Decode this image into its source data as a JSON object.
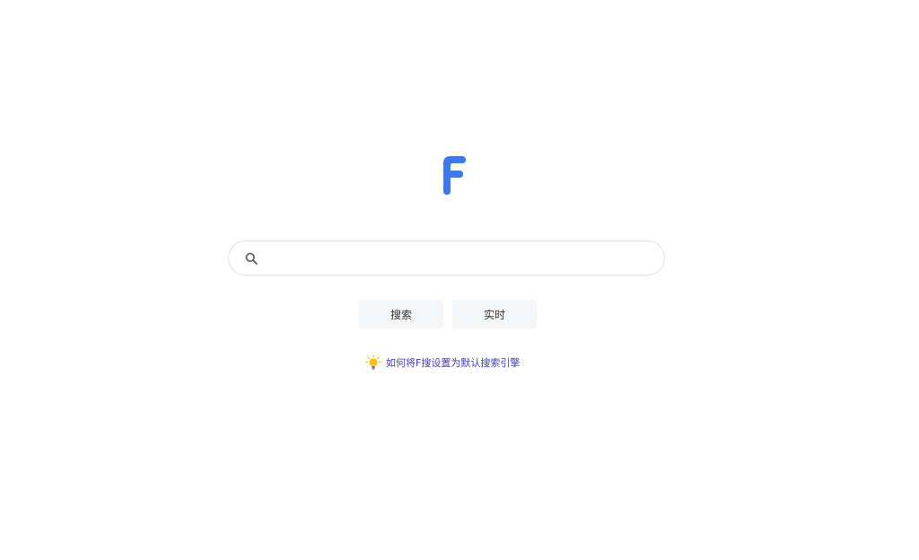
{
  "logo": {
    "letter": "F",
    "color": "#3b7ae8"
  },
  "search": {
    "placeholder": "",
    "value": "",
    "icon": "search-icon"
  },
  "buttons": {
    "search_label": "搜索",
    "realtime_label": "实时"
  },
  "tip": {
    "icon": "lightbulb-icon",
    "text": "如何将F搜设置为默认搜索引擎",
    "color": "#4440b0"
  }
}
